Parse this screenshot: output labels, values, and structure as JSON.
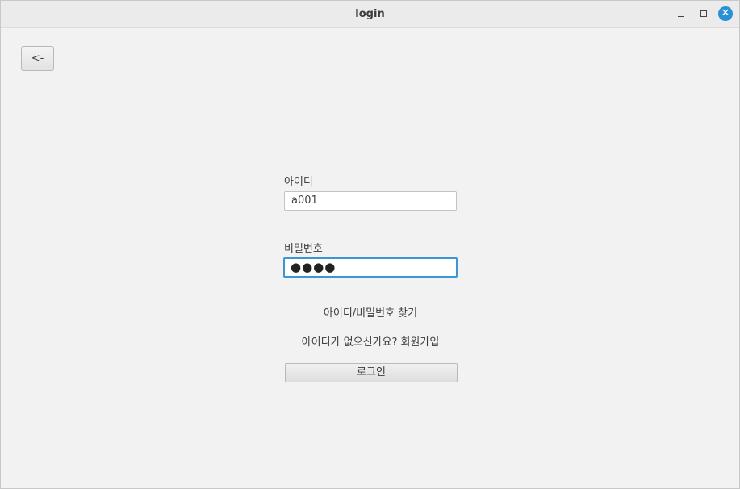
{
  "window": {
    "title": "login",
    "close_glyph": "✕",
    "accent_color": "#2b8fd6"
  },
  "nav": {
    "back_label": "<-"
  },
  "form": {
    "id_label": "아이디",
    "id_value": "a001",
    "password_label": "비밀번호",
    "password_masked": "●●●●"
  },
  "links": {
    "find_account": "아이디/비밀번호 찾기",
    "signup": "아이디가 없으신가요? 회원가입"
  },
  "actions": {
    "login_label": "로그인"
  }
}
